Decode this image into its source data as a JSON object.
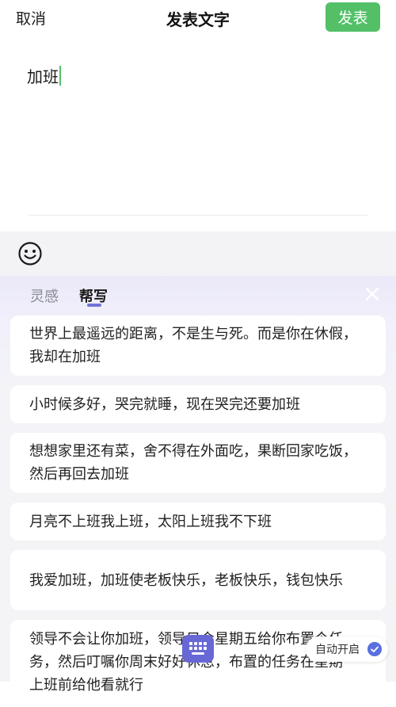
{
  "header": {
    "cancel_label": "取消",
    "title": "发表文字",
    "publish_label": "发表",
    "publish_color": "#53c068"
  },
  "editor": {
    "text": "加班"
  },
  "emoji_bar": {
    "icon": "emoji-smile-icon"
  },
  "helper": {
    "tabs": [
      {
        "label": "灵感",
        "active": false
      },
      {
        "label": "帮写",
        "active": true
      }
    ],
    "suggestions": [
      "世界上最遥远的距离，不是生与死。而是你在休假，我却在加班",
      "小时候多好，哭完就睡，现在哭完还要加班",
      "想想家里还有菜，舍不得在外面吃，果断回家吃饭，然后再回去加班",
      "月亮不上班我上班，太阳上班我不下班",
      "我爱加班，加班使老板快乐，老板快乐，钱包快乐",
      "领导不会让你加班，领导只会星期五给你布置个任务，然后叮嘱你周末好好休息，布置的任务在星期一上班前给他看就行"
    ],
    "auto_label": "自动开启",
    "accent_color": "#6867d6"
  }
}
